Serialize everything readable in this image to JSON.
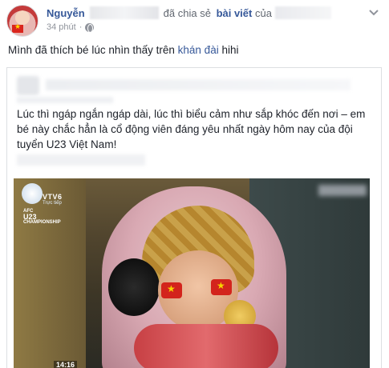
{
  "post": {
    "author_name": "Nguyễn",
    "shared_text": "đã chia sẻ",
    "post_link": "bài viết",
    "of_text": "của",
    "time": "34 phút",
    "separator": "·",
    "text_before": "Mình đã thích bé lúc nhìn thấy trên",
    "text_link": "khán đài",
    "text_after": "hihi"
  },
  "shared_card": {
    "text": "Lúc thì ngáp ngắn ngáp dài, lúc thì biểu cảm như sắp khóc đến nơi – em bé này chắc hẳn là cổ động viên đáng yêu nhất ngày hôm nay của đội tuyển U23 Việt Nam!"
  },
  "video": {
    "channel_logo": "VTV6",
    "live_label": "Trực tiếp",
    "event_line1": "AFC",
    "event_line2": "U23",
    "event_line3": "CHAMPIONSHIP",
    "timestamp": "14:16"
  },
  "colors": {
    "link": "#365899",
    "meta": "#90949c",
    "flag_red": "#da251d",
    "flag_star": "#ffde00"
  },
  "icons": [
    "globe-icon",
    "chevron-down-icon"
  ]
}
